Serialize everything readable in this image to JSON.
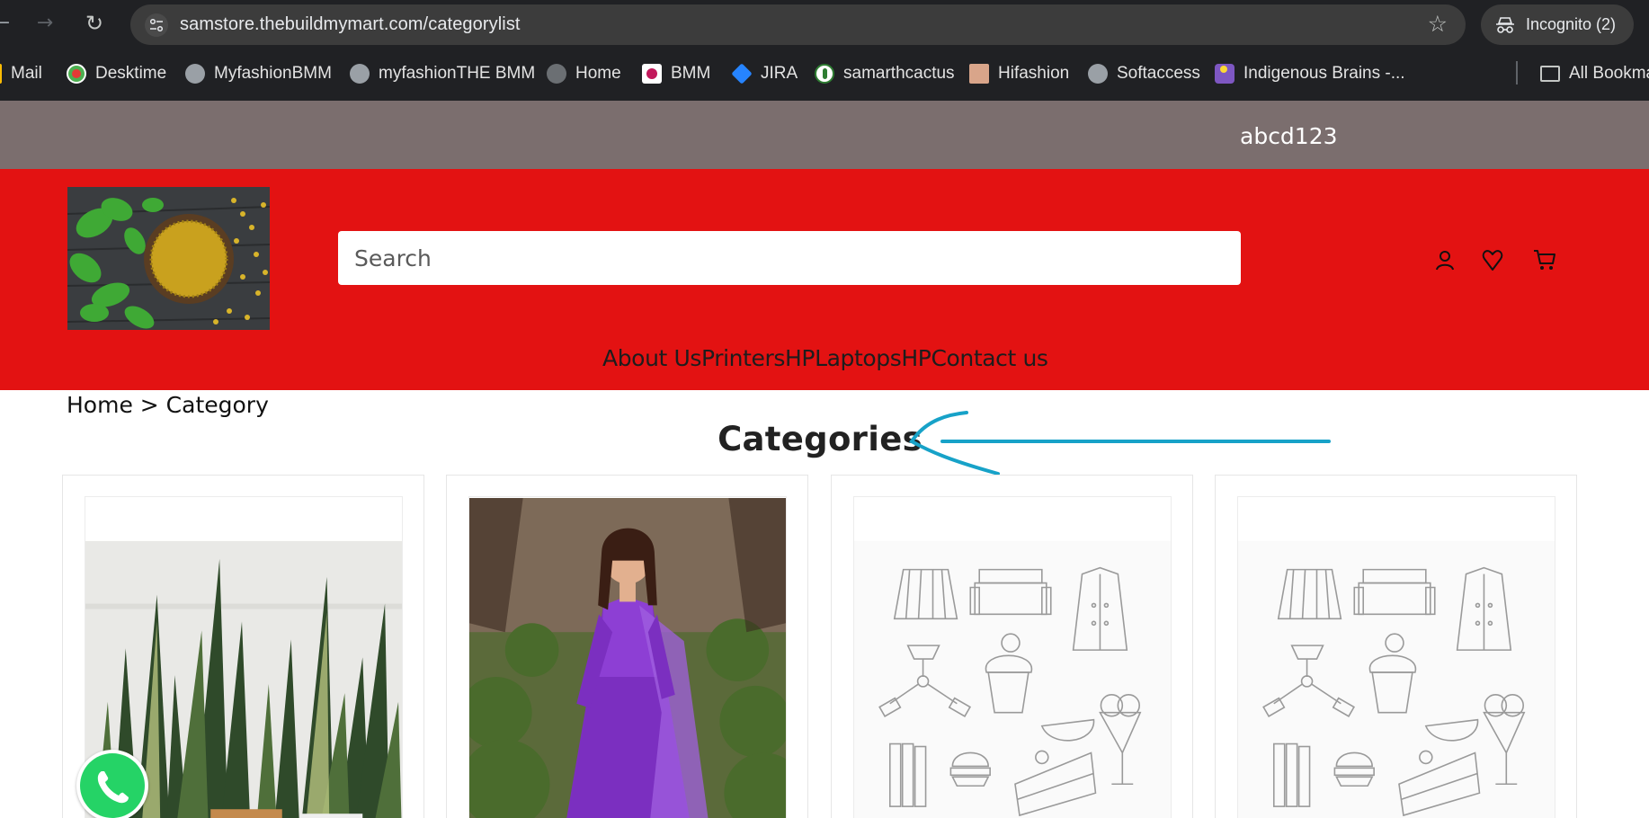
{
  "browser": {
    "url": "samstore.thebuildmymart.com/categorylist",
    "incognito_label": "Incognito (2)",
    "icons": [
      "back-icon",
      "forward-icon",
      "reload-icon",
      "site-info-icon",
      "star-icon",
      "incognito-icon"
    ]
  },
  "bookmarks": [
    {
      "label": "Mail",
      "icon": "gmail-icon"
    },
    {
      "label": "Desktime",
      "icon": "desktime-icon"
    },
    {
      "label": "MyfashionBMM",
      "icon": "globe-icon"
    },
    {
      "label": "myfashionTHE BMM",
      "icon": "globe-icon"
    },
    {
      "label": "Home",
      "icon": "globe-icon"
    },
    {
      "label": "BMM",
      "icon": "bmm-icon"
    },
    {
      "label": "JIRA",
      "icon": "jira-icon"
    },
    {
      "label": "samarthcactus",
      "icon": "cactus-icon"
    },
    {
      "label": "Hifashion",
      "icon": "hifashion-icon"
    },
    {
      "label": "Softaccess",
      "icon": "globe-icon"
    },
    {
      "label": "Indigenous Brains -...",
      "icon": "indigenous-icon"
    },
    {
      "label": "All Bookmarks",
      "icon": "folder-icon"
    }
  ],
  "site": {
    "top_strip_text": "abcd123",
    "search_placeholder": "Search",
    "header_icons": [
      "user-icon",
      "heart-icon",
      "cart-icon"
    ],
    "nav": [
      "About Us",
      "PrintersHP",
      "LaptopsHP",
      "Contact us"
    ],
    "breadcrumb": [
      "Home",
      " > ",
      "Category"
    ],
    "page_title": "Categories",
    "colors": {
      "header_red": "#e31212",
      "strip_gray": "#7b6e6e",
      "annotation_arrow": "#17a2c8",
      "whatsapp_green": "#25d366"
    }
  },
  "categories": [
    {
      "image": "snake-plants-photo"
    },
    {
      "image": "purple-dress-photo"
    },
    {
      "image": "placeholder-illustration"
    },
    {
      "image": "placeholder-illustration"
    }
  ],
  "floating": {
    "icon": "whatsapp-icon"
  }
}
